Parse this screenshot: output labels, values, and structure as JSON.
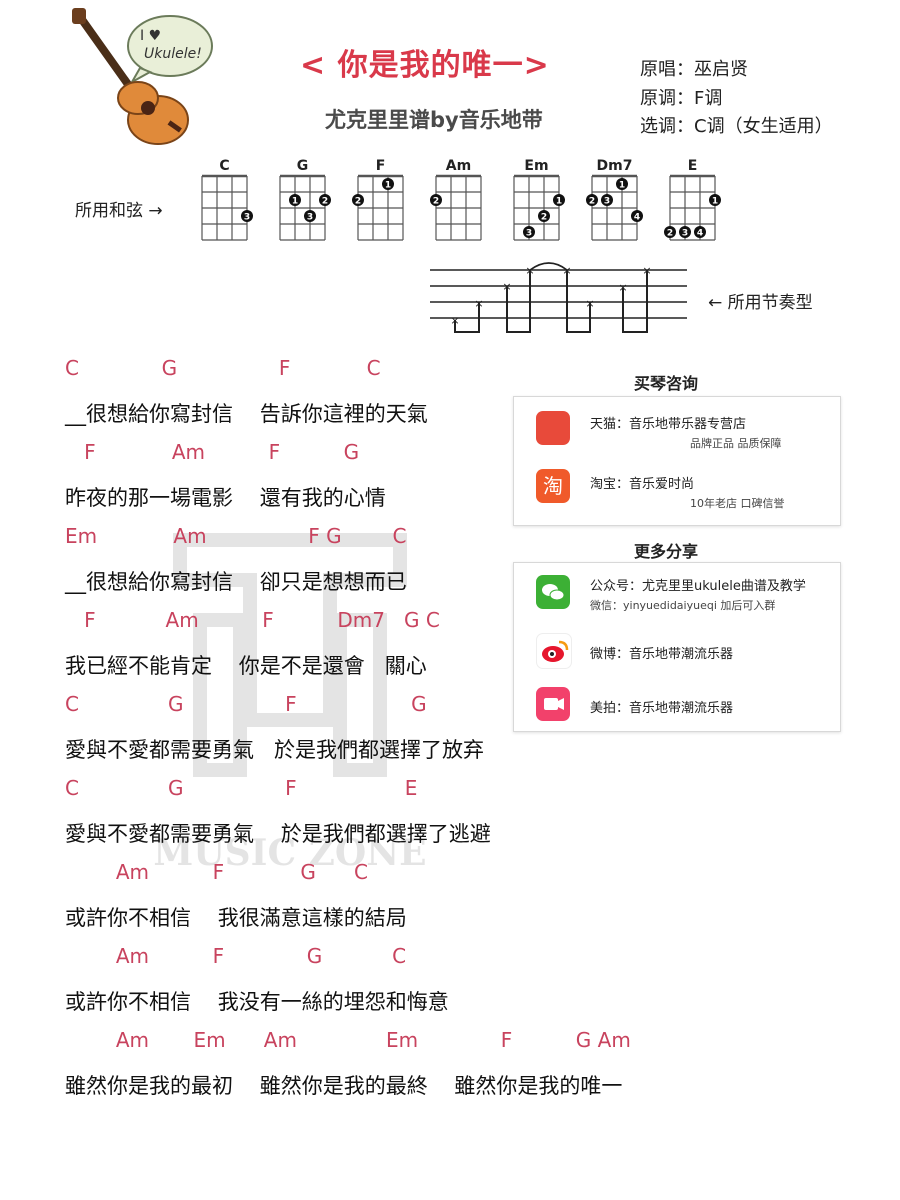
{
  "header": {
    "title": "< 你是我的唯一>",
    "subtitle": "尤克里里谱by音乐地带",
    "original_singer": "原唱：巫启贤",
    "original_key": "原调：F调",
    "selected_key": "选调：C调（女生适用）"
  },
  "logo": {
    "text": "Ukulele!",
    "icon": "ukulele-logo-icon",
    "heart": "I ♥"
  },
  "chord_section": {
    "label": "所用和弦 →",
    "chords": [
      {
        "name": "C",
        "dots": [
          {
            "fret": 3,
            "string": 4,
            "finger": "3"
          }
        ]
      },
      {
        "name": "G",
        "dots": [
          {
            "fret": 2,
            "string": 2,
            "finger": "1"
          },
          {
            "fret": 2,
            "string": 4,
            "finger": "2"
          },
          {
            "fret": 3,
            "string": 3,
            "finger": "3"
          }
        ]
      },
      {
        "name": "F",
        "dots": [
          {
            "fret": 1,
            "string": 3,
            "finger": "1"
          },
          {
            "fret": 2,
            "string": 1,
            "finger": "2"
          }
        ]
      },
      {
        "name": "Am",
        "dots": [
          {
            "fret": 2,
            "string": 1,
            "finger": "2"
          }
        ]
      },
      {
        "name": "Em",
        "dots": [
          {
            "fret": 2,
            "string": 4,
            "finger": "1"
          },
          {
            "fret": 3,
            "string": 3,
            "finger": "2"
          },
          {
            "fret": 4,
            "string": 2,
            "finger": "3"
          }
        ]
      },
      {
        "name": "Dm7",
        "dots": [
          {
            "fret": 1,
            "string": 3,
            "finger": "1"
          },
          {
            "fret": 2,
            "string": 1,
            "finger": "2"
          },
          {
            "fret": 2,
            "string": 2,
            "finger": "3"
          },
          {
            "fret": 3,
            "string": 4,
            "finger": "4"
          }
        ]
      },
      {
        "name": "E",
        "dots": [
          {
            "fret": 2,
            "string": 4,
            "finger": "1"
          },
          {
            "fret": 4,
            "string": 1,
            "finger": "2"
          },
          {
            "fret": 4,
            "string": 2,
            "finger": "3"
          },
          {
            "fret": 4,
            "string": 3,
            "finger": "4"
          }
        ]
      }
    ]
  },
  "rhythm": {
    "label": "← 所用节奏型"
  },
  "song": {
    "lines": [
      {
        "chords": "C             G                F            C",
        "lyric": "__很想給你寫封信    告訴你這裡的天氣"
      },
      {
        "chords": "   F            Am          F          G",
        "lyric": "昨夜的那一場電影    還有我的心情"
      },
      {
        "chords": "Em            Am                F G        C",
        "lyric": "__很想給你寫封信    卻只是想想而已"
      },
      {
        "chords": "   F           Am          F          Dm7   G C",
        "lyric": "我已經不能肯定    你是不是還會   關心"
      },
      {
        "chords": "C              G                F                  G",
        "lyric": "愛與不愛都需要勇氣   於是我們都選擇了放弃"
      },
      {
        "chords": "C              G                F                 E",
        "lyric": "愛與不愛都需要勇氣    於是我們都選擇了逃避"
      },
      {
        "chords": "        Am          F            G      C",
        "lyric": "或許你不相信    我很滿意這樣的結局"
      },
      {
        "chords": "        Am          F             G           C",
        "lyric": "或許你不相信    我没有一絲的埋怨和悔意"
      },
      {
        "chords": "        Am       Em      Am              Em             F          G Am",
        "lyric": "雖然你是我的最初    雖然你是我的最終    雖然你是我的唯一"
      }
    ]
  },
  "sidebar": {
    "buy_title": "买琴咨询",
    "shops": [
      {
        "icon": "tmall-icon",
        "name": "天猫：音乐地带乐器专营店",
        "sub": "品牌正品 品质保障",
        "color": "#e84a3a"
      },
      {
        "icon": "taobao-icon",
        "name": "淘宝：音乐爱时尚",
        "sub": "10年老店 口碑信誉",
        "color": "#f05a2a"
      }
    ],
    "share_title": "更多分享",
    "shares": [
      {
        "icon": "wechat-icon",
        "name": "公众号：尤克里里ukulele曲谱及教学",
        "sub": "微信：yinyuedidaiyueqi  加后可入群",
        "color": "#3cb035"
      },
      {
        "icon": "weibo-icon",
        "name": "微博：音乐地带潮流乐器",
        "sub": "",
        "color": "#e6162d"
      },
      {
        "icon": "meipai-icon",
        "name": "美拍：音乐地带潮流乐器",
        "sub": "",
        "color": "#f2416b"
      }
    ]
  },
  "watermark": {
    "text": "MUSIC ZONE"
  },
  "colors": {
    "title": "#d9394a",
    "chord": "#c8435e",
    "text": "#111111"
  }
}
